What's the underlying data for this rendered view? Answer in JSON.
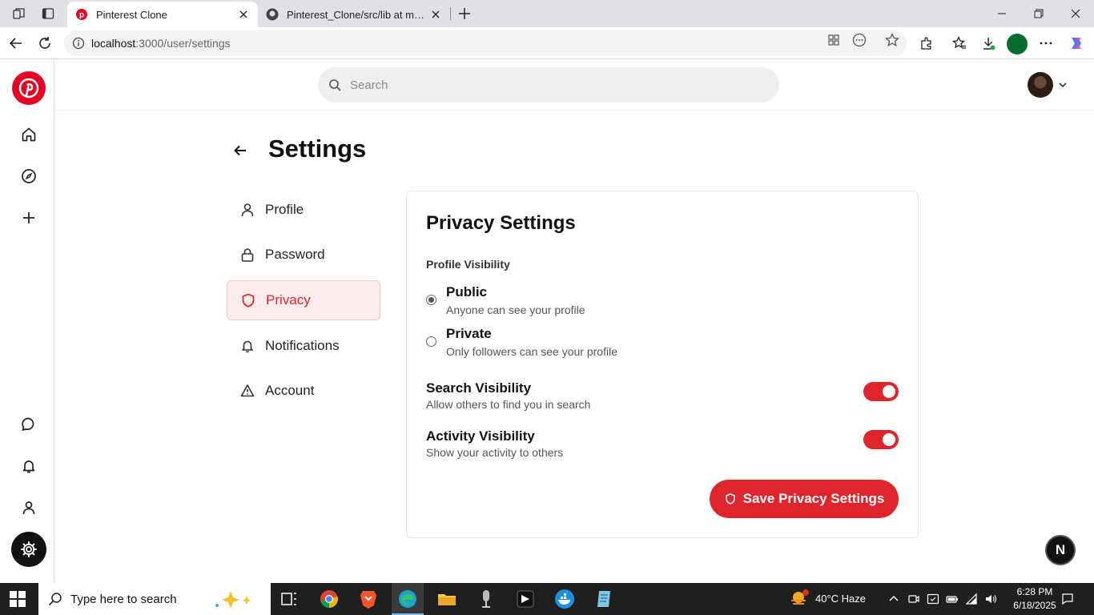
{
  "browser": {
    "tabs": [
      {
        "title": "Pinterest Clone",
        "active": true
      },
      {
        "title": "Pinterest_Clone/src/lib at main · M",
        "active": false
      }
    ],
    "url_host": "localhost",
    "url_path": ":3000/user/settings"
  },
  "header": {
    "search_placeholder": "Search"
  },
  "settings": {
    "title": "Settings",
    "menu": [
      {
        "label": "Profile",
        "icon": "user-icon"
      },
      {
        "label": "Password",
        "icon": "lock-icon"
      },
      {
        "label": "Privacy",
        "icon": "shield-icon",
        "active": true
      },
      {
        "label": "Notifications",
        "icon": "bell-icon"
      },
      {
        "label": "Account",
        "icon": "warning-icon"
      }
    ],
    "privacy": {
      "title": "Privacy Settings",
      "visibility_label": "Profile Visibility",
      "options": [
        {
          "title": "Public",
          "desc": "Anyone can see your profile",
          "selected": true
        },
        {
          "title": "Private",
          "desc": "Only followers can see your profile",
          "selected": false
        }
      ],
      "toggles": [
        {
          "title": "Search Visibility",
          "desc": "Allow others to find you in search",
          "on": true
        },
        {
          "title": "Activity Visibility",
          "desc": "Show your activity to others",
          "on": true
        }
      ],
      "save_label": "Save Privacy Settings"
    },
    "n_badge": "N"
  },
  "taskbar": {
    "search_text": "Type here to search",
    "weather": "40°C  Haze",
    "time": "6:28 PM",
    "date": "6/18/2025"
  },
  "colors": {
    "accent": "#e0242c",
    "pinterest": "#e60023"
  }
}
